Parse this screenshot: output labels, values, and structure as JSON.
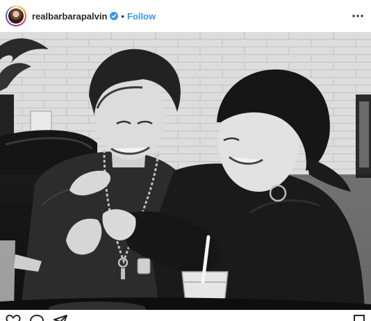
{
  "post": {
    "username": "realbarbarapalvin",
    "verified": true,
    "separator": "•",
    "follow_label": "Follow"
  },
  "photo": {
    "description": "Black and white photo of two people laughing in a booth",
    "style": "grayscale"
  },
  "icons": {
    "verified": "verified-badge-icon",
    "more": "more-options-icon",
    "like": "heart-icon",
    "comment": "comment-icon",
    "share": "share-icon",
    "save": "bookmark-icon"
  },
  "colors": {
    "accent": "#3897f0",
    "text": "#262626"
  }
}
